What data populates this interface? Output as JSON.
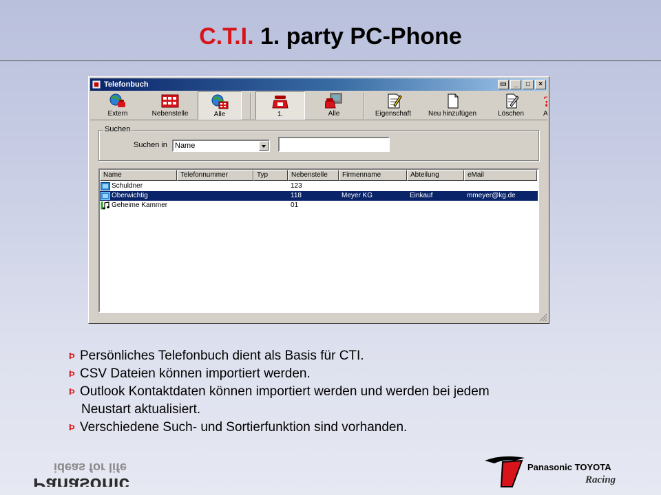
{
  "slide": {
    "title_accent": "C.T.I.",
    "title_rest": " 1. party PC-Phone"
  },
  "window": {
    "title": "Telefonbuch",
    "controls": [
      "▭",
      "_",
      "□",
      "×"
    ],
    "toolbar": [
      {
        "label": "Extern",
        "icon": "globe-phone-icon"
      },
      {
        "label": "Nebenstelle",
        "icon": "extensions-icon"
      },
      {
        "label": "Alle",
        "icon": "globe-extension-icon",
        "pressed": true
      },
      {
        "label": "1.",
        "icon": "red-phone-icon",
        "pressed": true
      },
      {
        "label": "Alle",
        "icon": "phone-group-icon"
      },
      {
        "label": "Eigenschaft",
        "icon": "properties-icon"
      },
      {
        "label": "Neu hinzufügen",
        "icon": "new-page-icon"
      },
      {
        "label": "Löschen",
        "icon": "delete-page-icon"
      },
      {
        "label": "Ar",
        "icon": "help-icon"
      }
    ],
    "search": {
      "group_label": "Suchen",
      "field_label": "Suchen in",
      "selected_option": "Name",
      "query_value": ""
    },
    "list": {
      "columns": [
        "Name",
        "Telefonnummer",
        "Typ",
        "Nebenstelle",
        "Firmenname",
        "Abteilung",
        "eMail"
      ],
      "rows": [
        {
          "name": "Schuldner",
          "phone": "",
          "type": "",
          "extension": "123",
          "company": "",
          "department": "",
          "email": "",
          "icon": "phone-book-icon",
          "selected": false
        },
        {
          "name": "Oberwichtig",
          "phone": "",
          "type": "",
          "extension": "118",
          "company": "Meyer KG",
          "department": "Einkauf",
          "email": "mmeyer@kg.de",
          "icon": "phone-book-icon",
          "selected": true
        },
        {
          "name": "Geheime Kammer",
          "phone": "",
          "type": "",
          "extension": "01",
          "company": "",
          "department": "",
          "email": "",
          "icon": "music-note-icon",
          "selected": false
        }
      ]
    }
  },
  "bullets": [
    {
      "mark": "Þ",
      "lines": [
        "Persönliches Telefonbuch dient als Basis für CTI."
      ]
    },
    {
      "mark": "Þ",
      "lines": [
        "CSV Dateien können importiert werden."
      ]
    },
    {
      "mark": "Þ",
      "lines": [
        "Outlook Kontaktdaten können importiert werden und werden bei jedem",
        "Neustart aktualisiert."
      ]
    },
    {
      "mark": "Þ",
      "lines": [
        "Verschiedene Such- und Sortierfunktion sind vorhanden."
      ]
    }
  ],
  "logos": {
    "left_brand": "Panasonic",
    "left_slogan": "ideas for life",
    "right_brand": "Panasonic TOYOTA",
    "right_sub": "Racing"
  },
  "colors": {
    "accent_red": "#d8141a",
    "titlebar_blue": "#0a246a",
    "selection_blue": "#0a246a",
    "window_gray": "#d4d0c8"
  }
}
